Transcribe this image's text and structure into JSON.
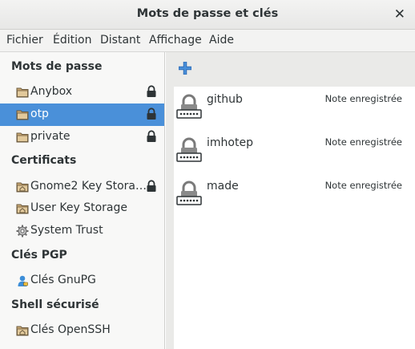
{
  "window": {
    "title": "Mots de passe et clés"
  },
  "menubar": [
    "Fichier",
    "Édition",
    "Distant",
    "Affichage",
    "Aide"
  ],
  "sidebar": {
    "sections": [
      {
        "title": "Mots de passe"
      },
      {
        "title": "Certificats"
      },
      {
        "title": "Clés PGP"
      },
      {
        "title": "Shell sécurisé"
      }
    ],
    "items": [
      {
        "label": "Anybox",
        "icon": "folder-icon",
        "locked": true,
        "selected": false
      },
      {
        "label": "otp",
        "icon": "folder-icon",
        "locked": true,
        "selected": true
      },
      {
        "label": "private",
        "icon": "folder-icon",
        "locked": true,
        "selected": false
      },
      {
        "label": "Gnome2 Key Stora…",
        "icon": "home-folder-icon",
        "locked": true,
        "selected": false
      },
      {
        "label": "User Key Storage",
        "icon": "home-folder-icon",
        "locked": false,
        "selected": false
      },
      {
        "label": "System Trust",
        "icon": "gear-icon",
        "locked": false,
        "selected": false
      },
      {
        "label": "Clés GnuPG",
        "icon": "person-icon",
        "locked": false,
        "selected": false
      },
      {
        "label": "Clés OpenSSH",
        "icon": "home-folder-icon",
        "locked": false,
        "selected": false
      }
    ]
  },
  "main": {
    "entries": [
      {
        "name": "github",
        "status": "Note enregistrée"
      },
      {
        "name": "imhotep",
        "status": "Note enregistrée"
      },
      {
        "name": "made",
        "status": "Note enregistrée"
      }
    ]
  }
}
